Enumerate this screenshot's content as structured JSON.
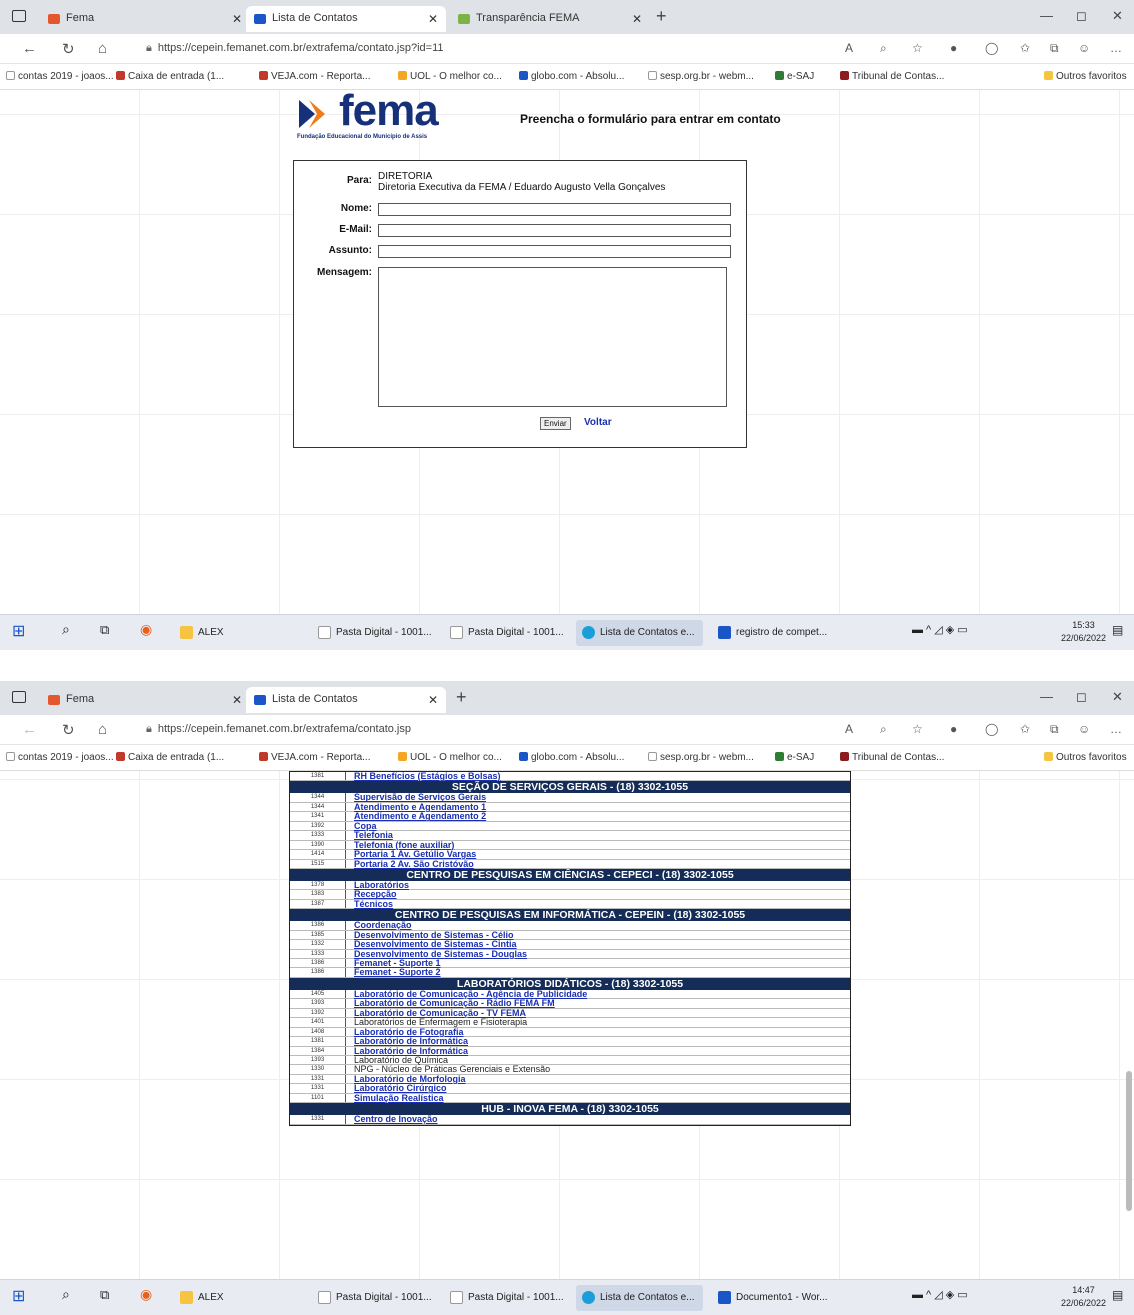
{
  "shot1": {
    "tabs": [
      {
        "label": "Fema",
        "active": false
      },
      {
        "label": "Lista de Contatos",
        "active": true
      },
      {
        "label": "Transparência FEMA",
        "active": false
      }
    ],
    "url": "https://cepein.femanet.com.br/extrafema/contato.jsp?id=11",
    "favorites": [
      "contas 2019 - joaos...",
      "Caixa de entrada (1...",
      "VEJA.com - Reporta...",
      "UOL - O melhor co...",
      "globo.com - Absolu...",
      "sesp.org.br - webm...",
      "e-SAJ",
      "Tribunal de Contas...",
      "Outros favoritos"
    ],
    "logo": {
      "word": "fema",
      "tagline": "Fundação Educacional do Município de Assis"
    },
    "form_title": "Preencha o formulário para entrar em contato",
    "form": {
      "para_label": "Para:",
      "para_line1": "DIRETORIA",
      "para_line2": "Diretoria Executiva da FEMA / Eduardo Augusto Vella Gonçalves",
      "nome_label": "Nome:",
      "email_label": "E-Mail:",
      "assunto_label": "Assunto:",
      "mensagem_label": "Mensagem:",
      "enviar": "Enviar",
      "voltar": "Voltar"
    },
    "taskbar": {
      "items": [
        "ALEX",
        "Pasta Digital - 1001...",
        "Pasta Digital - 1001...",
        "Lista de Contatos e...",
        "registro de compet..."
      ],
      "time": "15:33",
      "date": "22/06/2022"
    }
  },
  "shot2": {
    "tabs": [
      {
        "label": "Fema",
        "active": false
      },
      {
        "label": "Lista de Contatos",
        "active": true
      }
    ],
    "url": "https://cepein.femanet.com.br/extrafema/contato.jsp",
    "favorites": [
      "contas 2019 - joaos...",
      "Caixa de entrada (1...",
      "VEJA.com - Reporta...",
      "UOL - O melhor co...",
      "globo.com - Absolu...",
      "sesp.org.br - webm...",
      "e-SAJ",
      "Tribunal de Contas...",
      "Outros favoritos"
    ],
    "sections": [
      {
        "type": "row",
        "ext": "1381",
        "name": "RH Benefícios (Estágios e Bolsas)",
        "link": true
      },
      {
        "type": "header",
        "title": "SEÇÃO DE SERVIÇOS GERAIS - (18) 3302-1055"
      },
      {
        "type": "row",
        "ext": "1344",
        "name": "Supervisão de Serviços Gerais",
        "link": true
      },
      {
        "type": "row",
        "ext": "1344",
        "name": "Atendimento e Agendamento 1",
        "link": true
      },
      {
        "type": "row",
        "ext": "1341",
        "name": "Atendimento e Agendamento 2",
        "link": true
      },
      {
        "type": "row",
        "ext": "1392",
        "name": "Copa",
        "link": true
      },
      {
        "type": "row",
        "ext": "1333",
        "name": "Telefonia",
        "link": true
      },
      {
        "type": "row",
        "ext": "1390",
        "name": "Telefonia (fone auxiliar)",
        "link": true
      },
      {
        "type": "row",
        "ext": "1414",
        "name": "Portaria 1 Av. Getúlio Vargas",
        "link": true
      },
      {
        "type": "row",
        "ext": "1515",
        "name": "Portaria 2 Av. São Cristóvão",
        "link": true
      },
      {
        "type": "header",
        "title": "CENTRO DE PESQUISAS EM CIÊNCIAS - CEPECI - (18) 3302-1055"
      },
      {
        "type": "row",
        "ext": "1378",
        "name": "Laboratórios",
        "link": true
      },
      {
        "type": "row",
        "ext": "1383",
        "name": "Recepção",
        "link": true
      },
      {
        "type": "row",
        "ext": "1387",
        "name": "Técnicos",
        "link": true
      },
      {
        "type": "header",
        "title": "CENTRO DE PESQUISAS EM INFORMÁTICA - CEPEIN - (18) 3302-1055"
      },
      {
        "type": "row",
        "ext": "1386",
        "name": "Coordenação",
        "link": true
      },
      {
        "type": "row",
        "ext": "1385",
        "name": "Desenvolvimento de Sistemas - Célio",
        "link": true
      },
      {
        "type": "row",
        "ext": "1332",
        "name": "Desenvolvimento de Sistemas - Cintia",
        "link": true
      },
      {
        "type": "row",
        "ext": "1333",
        "name": "Desenvolvimento de Sistemas - Douglas",
        "link": true
      },
      {
        "type": "row",
        "ext": "1386",
        "name": "Femanet - Suporte 1",
        "link": true
      },
      {
        "type": "row",
        "ext": "1386",
        "name": "Femanet - Suporte 2",
        "link": true
      },
      {
        "type": "header",
        "title": "LABORATÓRIOS DIDÁTICOS - (18) 3302-1055"
      },
      {
        "type": "row",
        "ext": "1405",
        "name": "Laboratório de Comunicação - Agência de Publicidade",
        "link": true
      },
      {
        "type": "row",
        "ext": "1393",
        "name": "Laboratório de Comunicação - Rádio FEMA FM",
        "link": true
      },
      {
        "type": "row",
        "ext": "1392",
        "name": "Laboratório de Comunicação - TV FEMA",
        "link": true
      },
      {
        "type": "row",
        "ext": "1401",
        "name": "Laboratórios de Enfermagem e Fisioterapia",
        "link": false
      },
      {
        "type": "row",
        "ext": "1408",
        "name": "Laboratório de Fotografia",
        "link": true
      },
      {
        "type": "row",
        "ext": "1381",
        "name": "Laboratório de Informática",
        "link": true
      },
      {
        "type": "row",
        "ext": "1384",
        "name": "Laboratório de Informática",
        "link": true
      },
      {
        "type": "row",
        "ext": "1393",
        "name": "Laboratório de Química",
        "link": false
      },
      {
        "type": "row",
        "ext": "1330",
        "name": "NPG - Núcleo de Práticas Gerenciais e Extensão",
        "link": false
      },
      {
        "type": "row",
        "ext": "1331",
        "name": "Laboratório de Morfologia",
        "link": true
      },
      {
        "type": "row",
        "ext": "1331",
        "name": "Laboratório Cirúrgico",
        "link": true
      },
      {
        "type": "row",
        "ext": "1101",
        "name": "Simulação Realística",
        "link": true
      },
      {
        "type": "header",
        "title": "HUB - INOVA FEMA - (18) 3302-1055"
      },
      {
        "type": "row",
        "ext": "1331",
        "name": "Centro de Inovação",
        "link": true
      }
    ],
    "taskbar": {
      "items": [
        "ALEX",
        "Pasta Digital - 1001...",
        "Pasta Digital - 1001...",
        "Lista de Contatos e...",
        "Documento1 - Wor..."
      ],
      "time": "14:47",
      "date": "22/06/2022"
    }
  },
  "colors": {
    "fema_blue": "#16307a",
    "fema_orange": "#f07b1a",
    "header_navy": "#142c57",
    "link_blue": "#1a2fb0"
  }
}
